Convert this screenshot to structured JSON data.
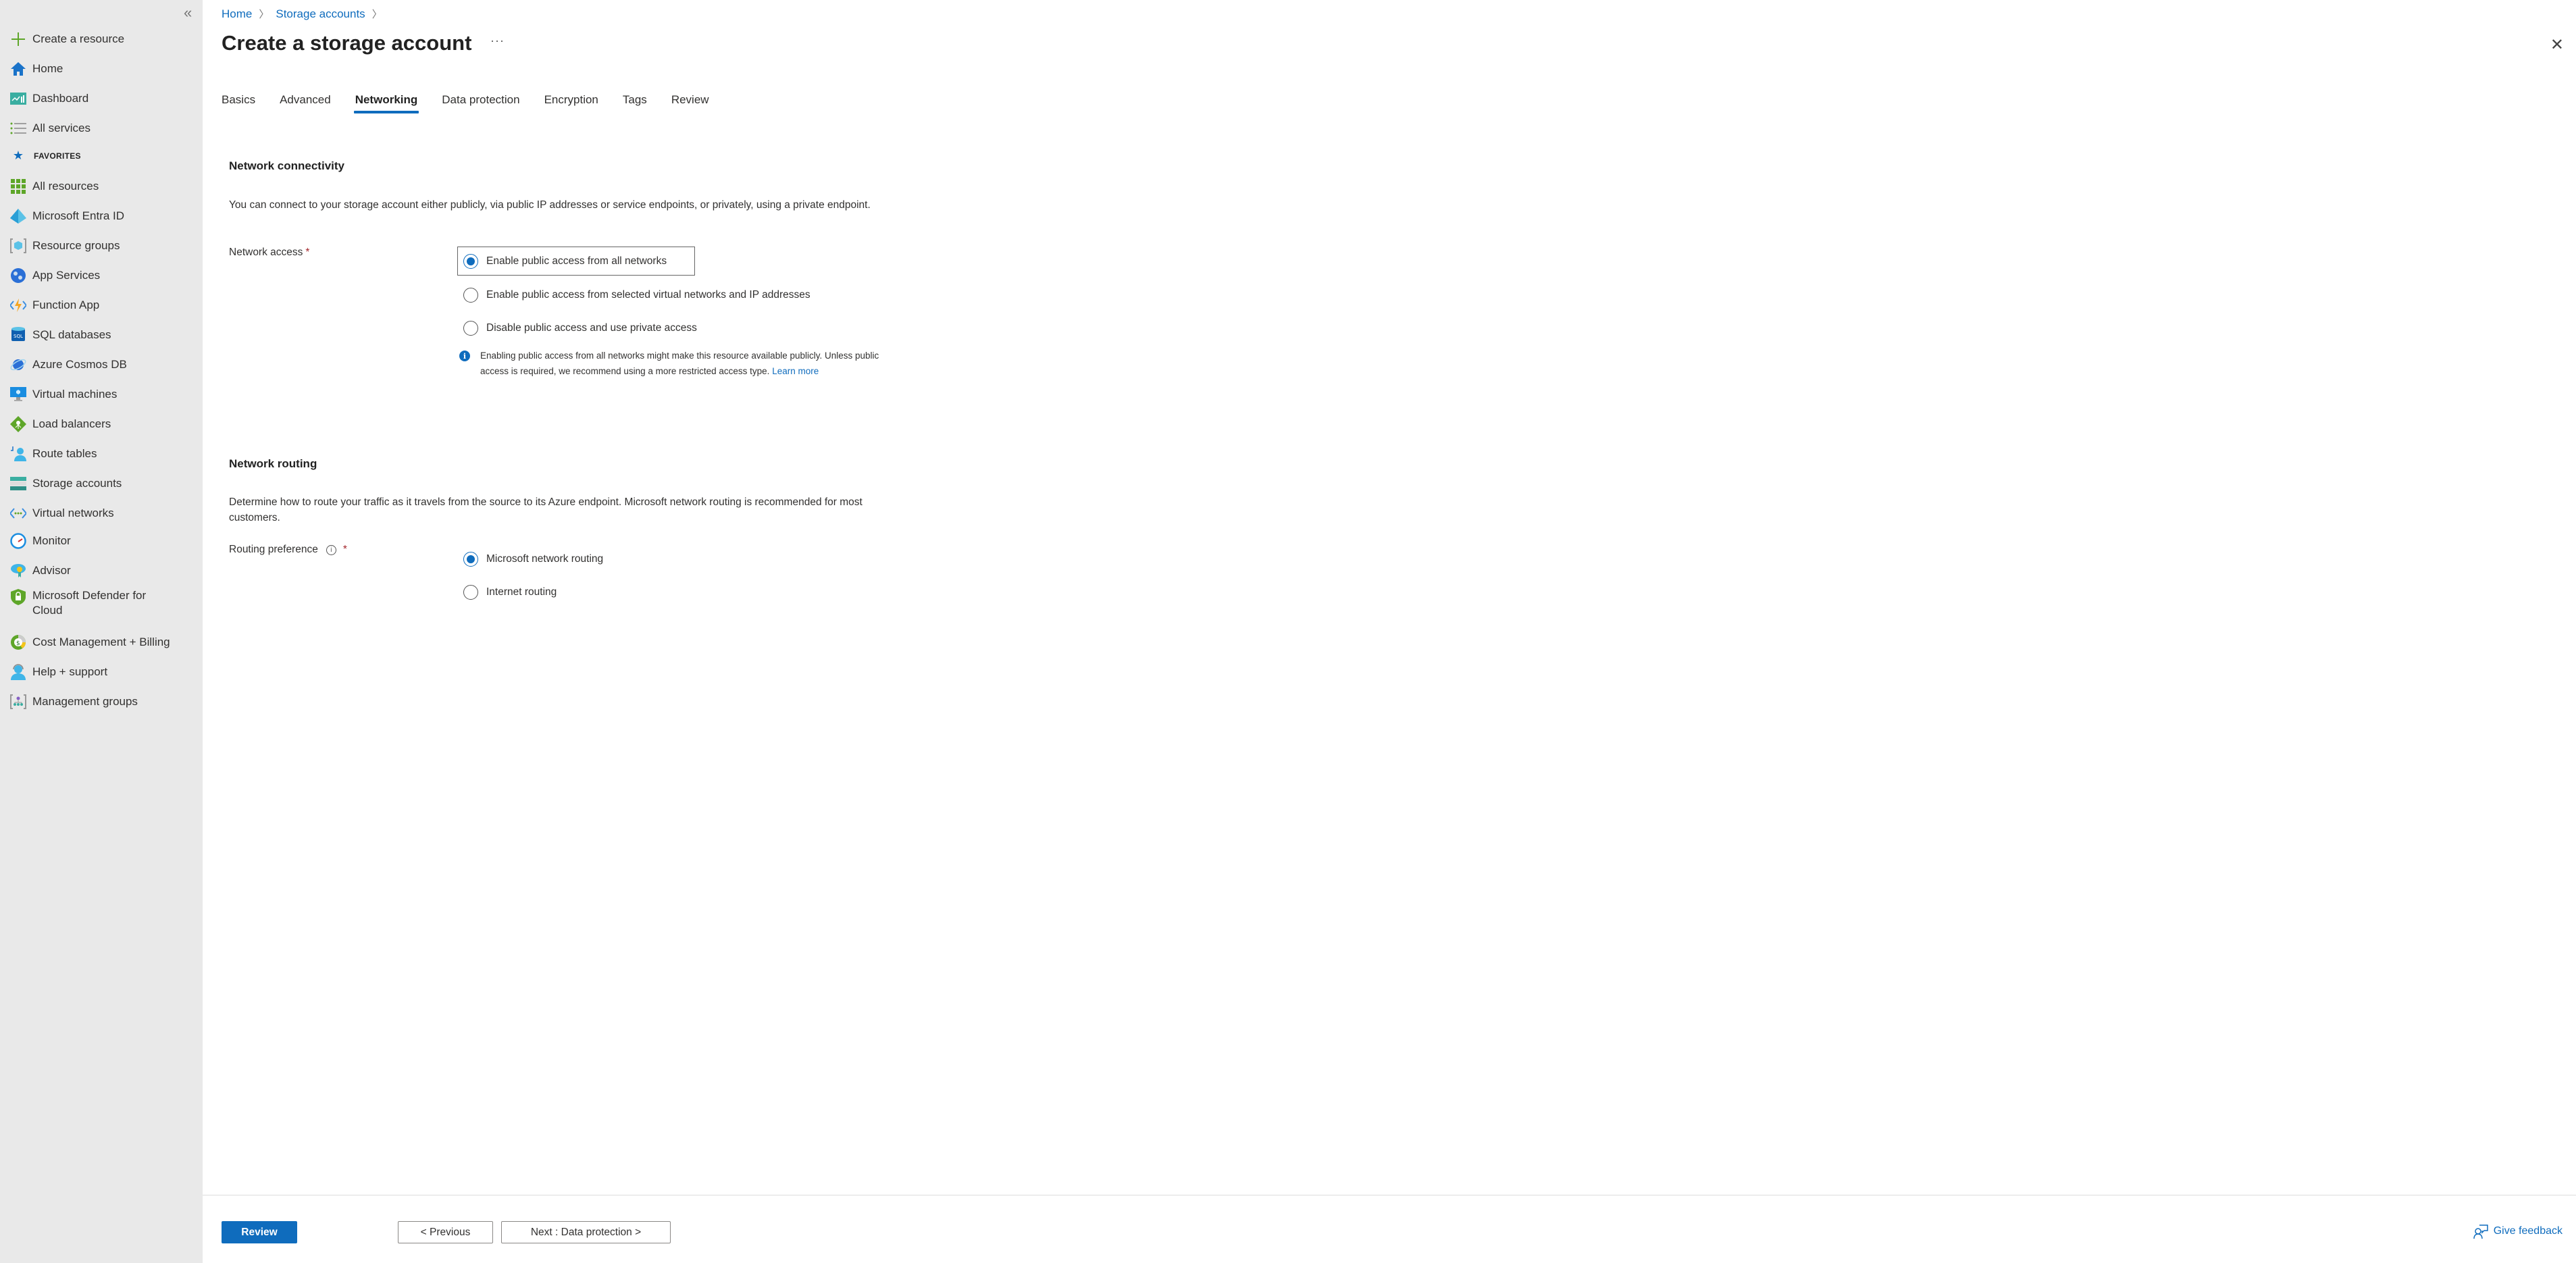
{
  "sidebar": {
    "collapse_label": "«",
    "items": [
      {
        "label": "Create a resource",
        "icon": "plus-icon"
      },
      {
        "label": "Home",
        "icon": "home-icon"
      },
      {
        "label": "Dashboard",
        "icon": "dashboard-icon"
      },
      {
        "label": "All services",
        "icon": "list-icon"
      }
    ],
    "favorites_label": "FAVORITES",
    "favorites": [
      {
        "label": "All resources",
        "icon": "grid-icon"
      },
      {
        "label": "Microsoft Entra ID",
        "icon": "entra-id-icon"
      },
      {
        "label": "Resource groups",
        "icon": "resource-group-icon"
      },
      {
        "label": "App Services",
        "icon": "app-services-icon"
      },
      {
        "label": "Function App",
        "icon": "function-app-icon"
      },
      {
        "label": "SQL databases",
        "icon": "sql-database-icon"
      },
      {
        "label": "Azure Cosmos DB",
        "icon": "cosmos-db-icon"
      },
      {
        "label": "Virtual machines",
        "icon": "virtual-machine-icon"
      },
      {
        "label": "Load balancers",
        "icon": "load-balancer-icon"
      },
      {
        "label": "Route tables",
        "icon": "route-table-icon"
      },
      {
        "label": "Storage accounts",
        "icon": "storage-account-icon"
      },
      {
        "label": "Virtual networks",
        "icon": "virtual-network-icon"
      },
      {
        "label": "Monitor",
        "icon": "monitor-icon"
      },
      {
        "label": "Advisor",
        "icon": "advisor-icon"
      },
      {
        "label": "Microsoft Defender for Cloud",
        "icon": "defender-icon"
      },
      {
        "label": "Cost Management + Billing",
        "icon": "cost-management-icon"
      },
      {
        "label": "Help + support",
        "icon": "help-support-icon"
      },
      {
        "label": "Management groups",
        "icon": "management-groups-icon"
      }
    ]
  },
  "header": {
    "breadcrumb": [
      "Home",
      "Storage accounts"
    ],
    "title": "Create a storage account",
    "more_label": "···",
    "close_label": "✕"
  },
  "tabs": [
    {
      "label": "Basics",
      "active": false
    },
    {
      "label": "Advanced",
      "active": false
    },
    {
      "label": "Networking",
      "active": true
    },
    {
      "label": "Data protection",
      "active": false
    },
    {
      "label": "Encryption",
      "active": false
    },
    {
      "label": "Tags",
      "active": false
    },
    {
      "label": "Review",
      "active": false
    }
  ],
  "connectivity": {
    "title": "Network connectivity",
    "description": "You can connect to your storage account either publicly, via public IP addresses or service endpoints, or privately, using a private endpoint.",
    "field_label": "Network access",
    "required_mark": "*",
    "options": [
      {
        "label": "Enable public access from all networks",
        "checked": true
      },
      {
        "label": "Enable public access from selected virtual networks and IP addresses",
        "checked": false
      },
      {
        "label": "Disable public access and use private access",
        "checked": false
      }
    ],
    "info_text": "Enabling public access from all networks might make this resource available publicly. Unless public access is required, we recommend using a more restricted access type.",
    "info_link": "Learn more"
  },
  "routing": {
    "title": "Network routing",
    "description": "Determine how to route your traffic as it travels from the source to its Azure endpoint. Microsoft network routing is recommended for most customers.",
    "field_label": "Routing preference",
    "required_mark": "*",
    "options": [
      {
        "label": "Microsoft network routing",
        "checked": true
      },
      {
        "label": "Internet routing",
        "checked": false
      }
    ]
  },
  "footer": {
    "review_label": "Review",
    "previous_label": "< Previous",
    "next_label": "Next : Data protection >",
    "feedback_label": "Give feedback"
  },
  "colors": {
    "accent": "#0f6cbd",
    "sidebar_bg": "#e9e9e9",
    "required": "#a4262c"
  }
}
